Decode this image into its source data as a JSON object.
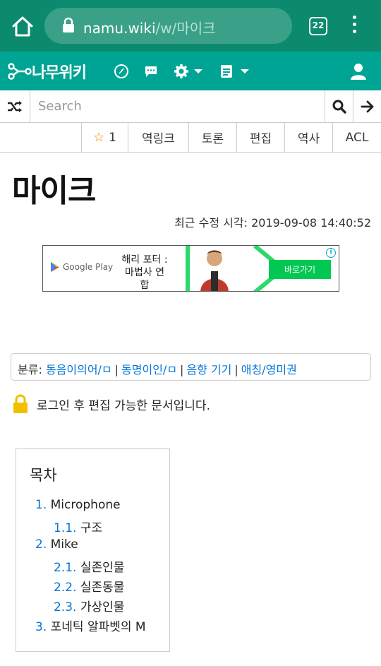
{
  "browser": {
    "url_host": "namu.wiki",
    "url_path": "/w/마이크",
    "tab_count": "22"
  },
  "site": {
    "logo_text": "나무위키",
    "icons": [
      "recent-changes-icon",
      "discussion-icon",
      "settings-icon",
      "document-icon",
      "user-icon"
    ]
  },
  "search": {
    "placeholder": "Search"
  },
  "tabs": {
    "star_count": "1",
    "backlinks": "역링크",
    "discussion": "토론",
    "edit": "편집",
    "history": "역사",
    "acl": "ACL"
  },
  "article": {
    "title": "마이크",
    "last_modified_label": "최근 수정 시각:",
    "last_modified_value": "2019-09-08 14:40:52"
  },
  "ad": {
    "store": "Google Play",
    "headline_line1": "해리 포터 :",
    "headline_line2": "마법사 연합",
    "cta": "바로가기",
    "info": "i"
  },
  "categories": {
    "label": "분류:",
    "items": [
      "동음이의어/ㅁ",
      "동명이인/ㅁ",
      "음향 기기",
      "애칭/영미권"
    ]
  },
  "protection_notice": "로그인 후 편집 가능한 문서입니다.",
  "toc": {
    "title": "목차",
    "items": [
      {
        "num": "1.",
        "label": "Microphone"
      },
      {
        "num": "1.1.",
        "label": "구조"
      },
      {
        "num": "2.",
        "label": "Mike"
      },
      {
        "num": "2.1.",
        "label": "실존인물"
      },
      {
        "num": "2.2.",
        "label": "실존동물"
      },
      {
        "num": "2.3.",
        "label": "가상인물"
      },
      {
        "num": "3.",
        "label": "포네틱 알파벳의 M"
      }
    ]
  },
  "colors": {
    "browser_bar": "#0b8a6d",
    "site_nav": "#00a495",
    "link": "#0275d8",
    "star": "#ff7f00",
    "lock": "#f0c000"
  }
}
